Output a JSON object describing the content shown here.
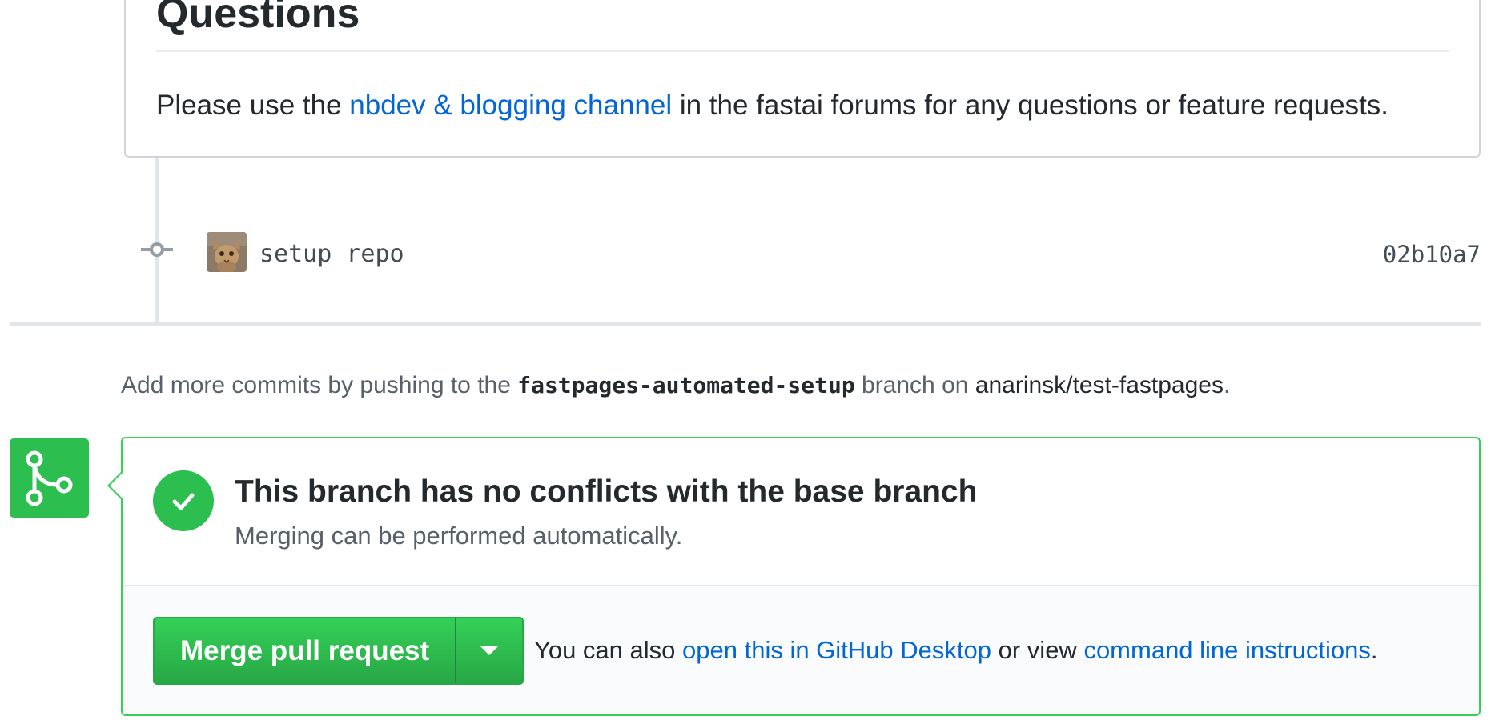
{
  "comment": {
    "heading": "Questions",
    "body_before": "Please use the ",
    "body_link": "nbdev & blogging channel",
    "body_after": " in the fastai forums for any questions or feature requests."
  },
  "commit": {
    "message": "setup repo",
    "sha": "02b10a7"
  },
  "push_note": {
    "prefix": "Add more commits by pushing to the ",
    "branch": "fastpages-automated-setup",
    "middle": " branch on ",
    "repo": "anarinsk/test-fastpages",
    "suffix": "."
  },
  "merge": {
    "status_title": "This branch has no conflicts with the base branch",
    "status_subtitle": "Merging can be performed automatically.",
    "merge_button_label": "Merge pull request",
    "alt_prefix": "You can also ",
    "alt_link_desktop": "open this in GitHub Desktop",
    "alt_middle": " or view ",
    "alt_link_cli": "command line instructions",
    "alt_suffix": "."
  },
  "colors": {
    "success_green": "#2cbe4e",
    "link_blue": "#0366d6",
    "border_gray": "#d1d5da"
  },
  "icons": {
    "commit": "git-commit-icon",
    "merge_badge": "git-merge-icon",
    "status": "check-icon",
    "dropdown": "triangle-down-icon"
  }
}
